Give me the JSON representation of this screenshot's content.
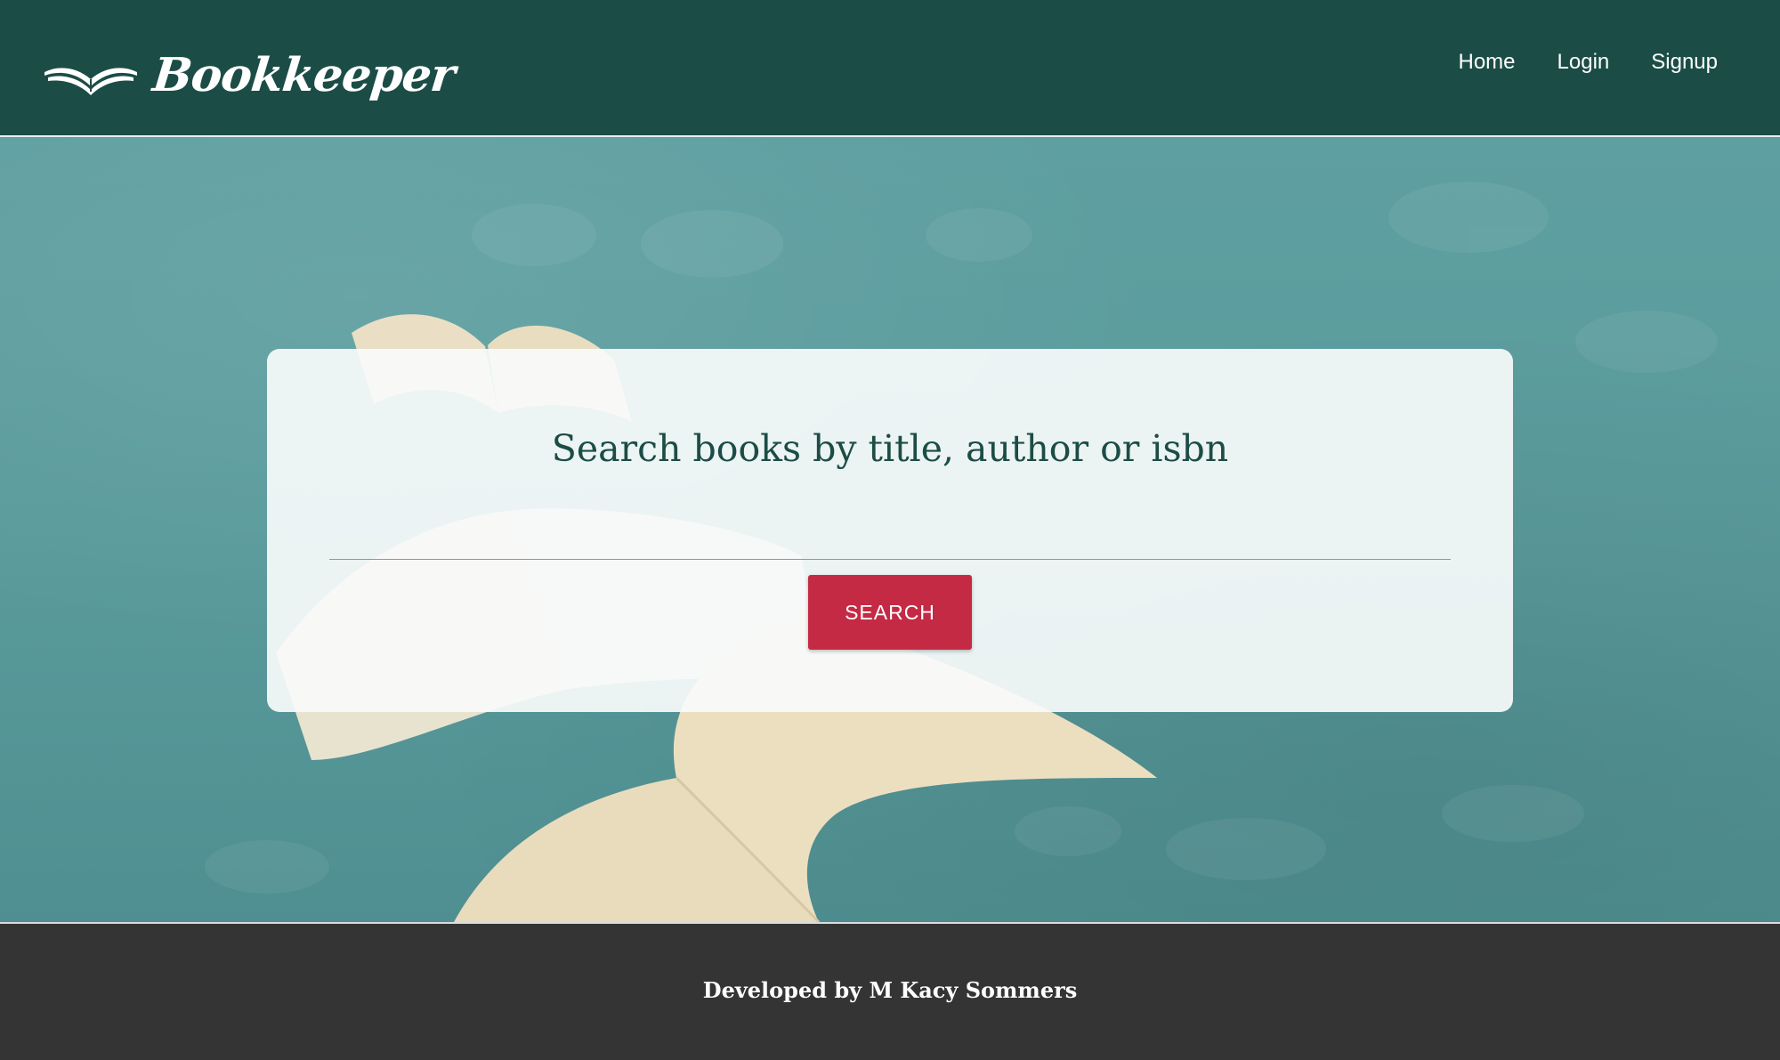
{
  "header": {
    "logo_text": "Bookkeeper",
    "logo_icon": "open-book-icon",
    "nav": [
      {
        "label": "Home"
      },
      {
        "label": "Login"
      },
      {
        "label": "Signup"
      }
    ]
  },
  "main": {
    "title": "Search books by title, author or isbn",
    "search_input": {
      "value": "",
      "placeholder": ""
    },
    "search_button_label": "SEARCH"
  },
  "footer": {
    "text": "Developed by M Kacy Sommers"
  },
  "colors": {
    "header_bg": "#1b4d46",
    "accent_button": "#c52a45",
    "title_text": "#1b4d46",
    "footer_bg": "#343434",
    "hero_bg": "#5a9b9c"
  }
}
